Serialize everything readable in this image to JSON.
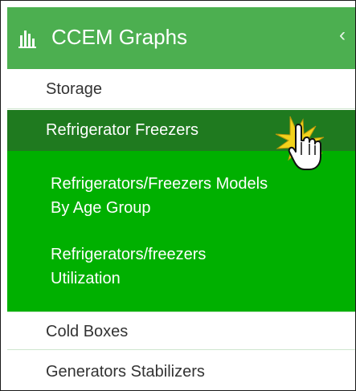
{
  "header": {
    "title": "CCEM Graphs",
    "logo_icon": "bar-chart-icon",
    "collapse_glyph": "‹",
    "background": "#4caf50"
  },
  "menu": {
    "storage": "Storage",
    "active": "Refrigerator Freezers",
    "cold_boxes": "Cold Boxes",
    "generators": "Generators Stabilizers"
  },
  "submenu": {
    "item1_line1": "Refrigerators/Freezers Models",
    "item1_line2": "By Age Group",
    "item2_line1": "Refrigerators/freezers",
    "item2_line2": "Utilization"
  },
  "colors": {
    "active_bg": "#1f7a1f",
    "submenu_bg": "#00b000",
    "click_highlight": "#f2d21b"
  }
}
